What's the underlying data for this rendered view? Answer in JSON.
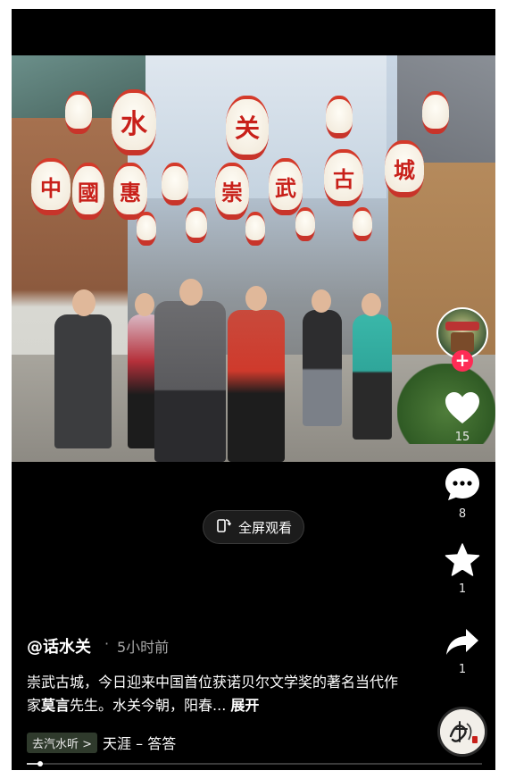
{
  "video": {
    "lantern_chars": [
      "水",
      "关",
      "古",
      "城",
      "中",
      "國",
      "惠",
      "崇",
      "武"
    ]
  },
  "fullscreen_label": "全屏观看",
  "rail": {
    "like_count": "15",
    "comment_count": "8",
    "favorite_count": "1",
    "share_count": "1"
  },
  "post": {
    "author": "@话水关",
    "separator": "·",
    "time": "5小时前",
    "desc_part1": "崇武古城，今日迎来中国首位获诺贝尔文学奖的著名当代作家",
    "desc_bold": "莫言",
    "desc_part2": "先生。水关今朝，阳春...",
    "expand_label": "展开"
  },
  "music": {
    "tag": "去汽水听 >",
    "title": "天涯 – 答答"
  },
  "progress": {
    "fraction": 0.03
  },
  "colors": {
    "accent": "#fe2c55",
    "lantern_red": "#c8201a"
  }
}
